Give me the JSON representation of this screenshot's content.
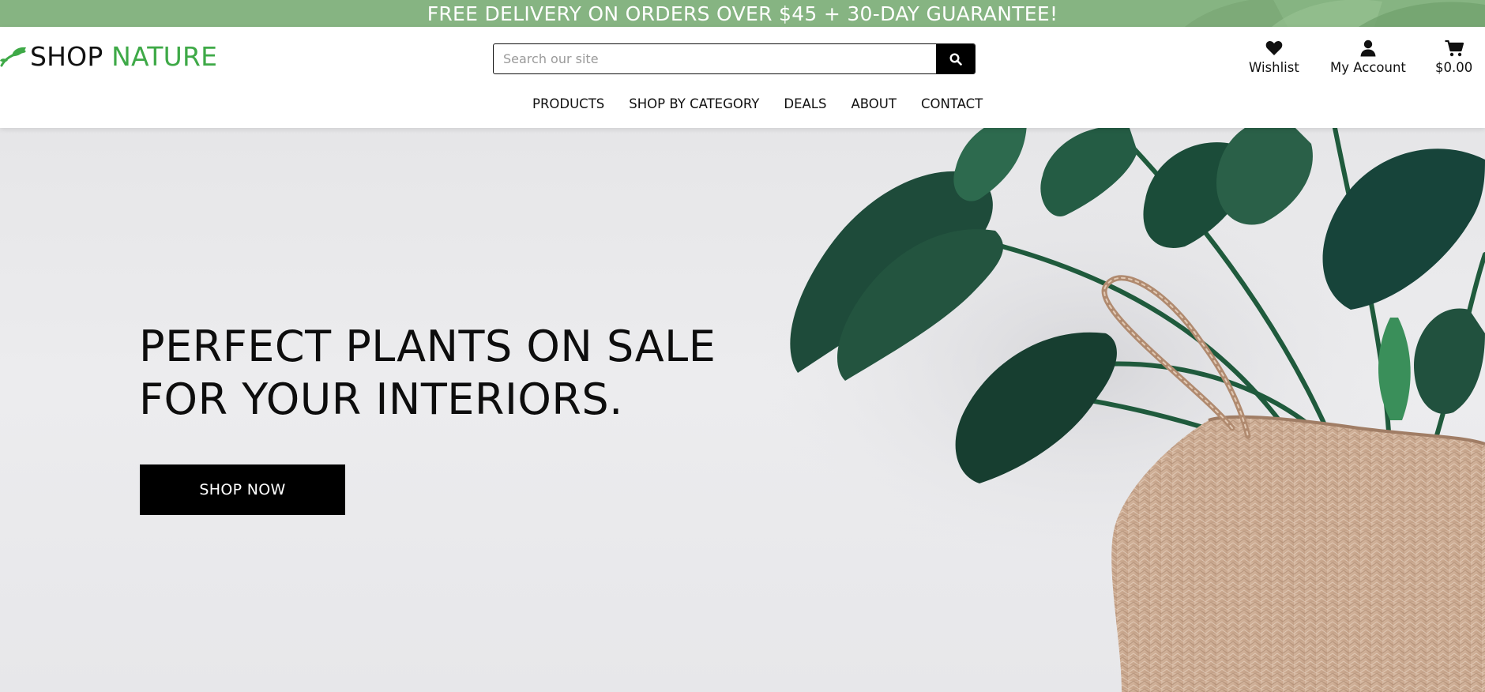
{
  "promo": {
    "text": "FREE DELIVERY ON ORDERS OVER $45 + 30-DAY GUARANTEE!",
    "background": "#86b482"
  },
  "brand": {
    "name_part1": "SHOP",
    "name_part2": "NATURE",
    "accent_color": "#3ea947",
    "icon": "leaf-icon"
  },
  "search": {
    "placeholder": "Search our site",
    "value": "",
    "button_icon": "search-icon"
  },
  "nav": {
    "items": [
      "PRODUCTS",
      "SHOP BY CATEGORY",
      "DEALS",
      "ABOUT",
      "CONTACT"
    ]
  },
  "utility": {
    "wishlist": {
      "label": "Wishlist",
      "icon": "heart-icon"
    },
    "account": {
      "label": "My Account",
      "icon": "user-icon"
    },
    "cart": {
      "label": "$0.00",
      "icon": "cart-icon"
    }
  },
  "hero": {
    "title_line1": "PERFECT PLANTS ON SALE",
    "title_line2": "FOR YOUR INTERIORS.",
    "cta_label": "SHOP NOW",
    "image": "monstera plant in woven basket"
  }
}
